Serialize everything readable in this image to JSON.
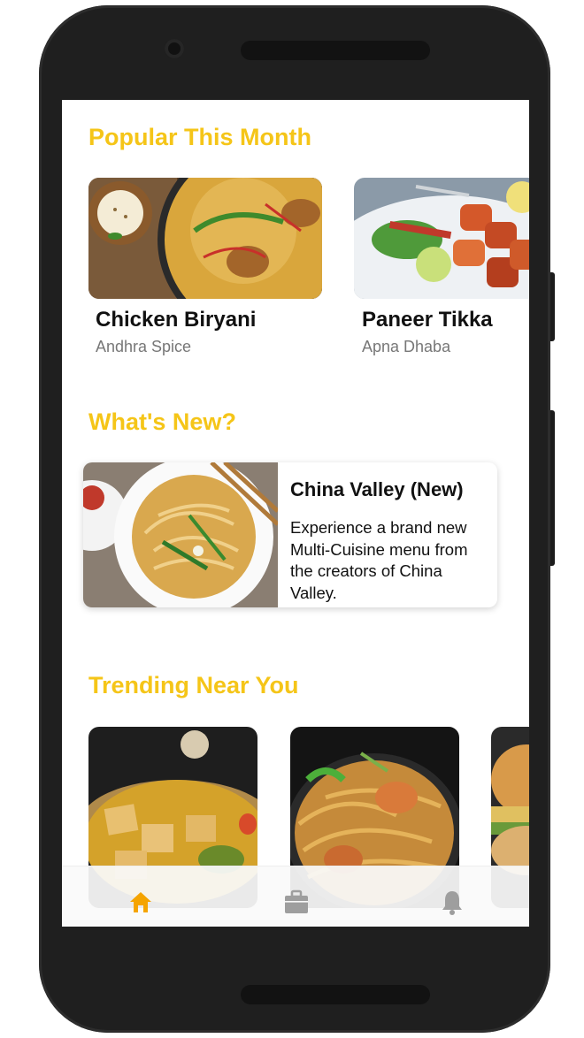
{
  "sections": {
    "popular_title": "Popular This Month",
    "new_title": "What's New?",
    "trending_title": "Trending Near You"
  },
  "popular": [
    {
      "name": "Chicken Biryani",
      "restaurant": "Andhra Spice"
    },
    {
      "name": "Paneer Tikka",
      "restaurant": "Apna Dhaba"
    }
  ],
  "whats_new": {
    "title": "China Valley (New)",
    "description": "Experience a brand new Multi-Cuisine menu from the creators of China Valley."
  },
  "trending": [
    {
      "image": "paneer-curry"
    },
    {
      "image": "noodles"
    },
    {
      "image": "vada-pav"
    }
  ],
  "bottom_nav": {
    "items": [
      {
        "icon": "home-icon",
        "active": true
      },
      {
        "icon": "briefcase-icon",
        "active": false
      },
      {
        "icon": "bell-icon",
        "active": false
      }
    ]
  },
  "colors": {
    "accent": "#f5c518",
    "nav_active": "#f5a400",
    "nav_inactive": "#9e9e9e"
  }
}
